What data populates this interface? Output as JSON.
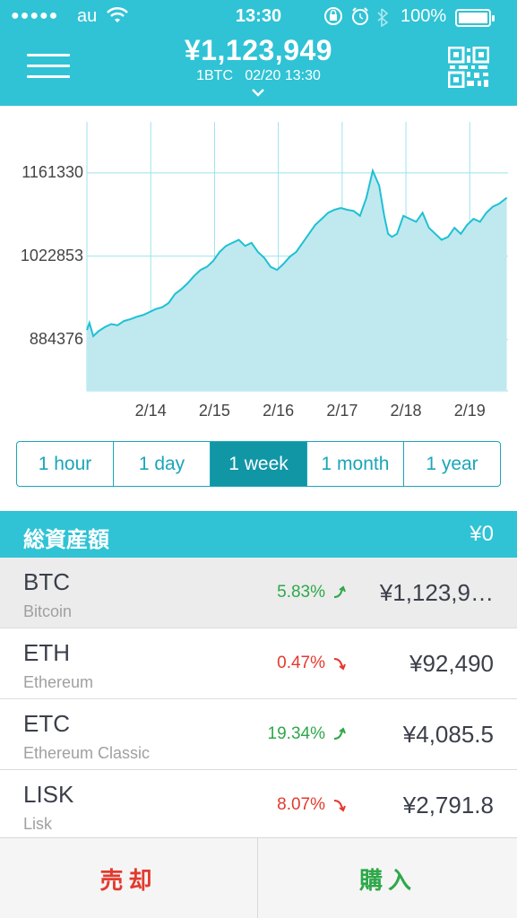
{
  "status": {
    "dots": "●●●●●",
    "carrier": "au",
    "time": "13:30",
    "battery": "100%"
  },
  "header": {
    "price": "¥1,123,949",
    "subtitle": "1BTC   02/20 13:30"
  },
  "chart_data": {
    "type": "area",
    "yticks": [
      {
        "label": "1161330",
        "value": 1161330
      },
      {
        "label": "1022853",
        "value": 1022853
      },
      {
        "label": "884376",
        "value": 884376
      }
    ],
    "xticks": [
      {
        "label": "2/14",
        "value": 1
      },
      {
        "label": "2/15",
        "value": 2
      },
      {
        "label": "2/16",
        "value": 3
      },
      {
        "label": "2/17",
        "value": 4
      },
      {
        "label": "2/18",
        "value": 5
      },
      {
        "label": "2/19",
        "value": 6
      }
    ],
    "ylim": [
      799000,
      1246000
    ],
    "xlim": [
      0.0,
      6.6
    ],
    "series": [
      {
        "x": [
          0.0,
          0.04,
          0.1,
          0.18,
          0.28,
          0.38,
          0.48,
          0.58,
          0.68,
          0.78,
          0.88,
          0.98,
          1.08,
          1.18,
          1.28,
          1.38,
          1.48,
          1.58,
          1.68,
          1.78,
          1.88,
          1.98,
          2.08,
          2.18,
          2.28,
          2.38,
          2.48,
          2.58,
          2.68,
          2.78,
          2.88,
          2.98,
          3.08,
          3.18,
          3.28,
          3.38,
          3.48,
          3.58,
          3.68,
          3.78,
          3.88,
          3.98,
          4.08,
          4.18,
          4.28,
          4.38,
          4.48,
          4.58,
          4.66,
          4.72,
          4.78,
          4.86,
          4.96,
          5.06,
          5.16,
          5.26,
          5.36,
          5.46,
          5.56,
          5.66,
          5.76,
          5.86,
          5.96,
          6.06,
          6.16,
          6.26,
          6.36,
          6.46,
          6.58
        ],
        "y": [
          900000,
          912000,
          890000,
          898000,
          905000,
          910000,
          908000,
          915000,
          918000,
          922000,
          925000,
          930000,
          935000,
          938000,
          945000,
          960000,
          968000,
          978000,
          990000,
          1000000,
          1005000,
          1015000,
          1030000,
          1040000,
          1045000,
          1050000,
          1040000,
          1045000,
          1030000,
          1020000,
          1005000,
          1000000,
          1010000,
          1022000,
          1030000,
          1045000,
          1060000,
          1075000,
          1085000,
          1095000,
          1100000,
          1103000,
          1100000,
          1098000,
          1090000,
          1120000,
          1165000,
          1140000,
          1090000,
          1060000,
          1055000,
          1060000,
          1090000,
          1085000,
          1080000,
          1095000,
          1070000,
          1060000,
          1050000,
          1055000,
          1070000,
          1060000,
          1075000,
          1085000,
          1080000,
          1095000,
          1105000,
          1110000,
          1120000
        ]
      }
    ]
  },
  "ranges": [
    {
      "label": "1 hour",
      "active": false
    },
    {
      "label": "1 day",
      "active": false
    },
    {
      "label": "1 week",
      "active": true
    },
    {
      "label": "1 month",
      "active": false
    },
    {
      "label": "1 year",
      "active": false
    }
  ],
  "assets": {
    "label": "総資産額",
    "value": "¥0"
  },
  "coins": [
    {
      "symbol": "BTC",
      "name": "Bitcoin",
      "change": "5.83%",
      "direction": "up",
      "price": "¥1,123,9…",
      "selected": true
    },
    {
      "symbol": "ETH",
      "name": "Ethereum",
      "change": "0.47%",
      "direction": "down",
      "price": "¥92,490",
      "selected": false
    },
    {
      "symbol": "ETC",
      "name": "Ethereum Classic",
      "change": "19.34%",
      "direction": "up",
      "price": "¥4,085.5",
      "selected": false
    },
    {
      "symbol": "LISK",
      "name": "Lisk",
      "change": "8.07%",
      "direction": "down",
      "price": "¥2,791.8",
      "selected": false
    }
  ],
  "actions": {
    "sell": "売却",
    "buy": "購入"
  },
  "colors": {
    "brand": "#2fc3d5",
    "up": "#2ea84a",
    "down": "#e33a2e"
  }
}
